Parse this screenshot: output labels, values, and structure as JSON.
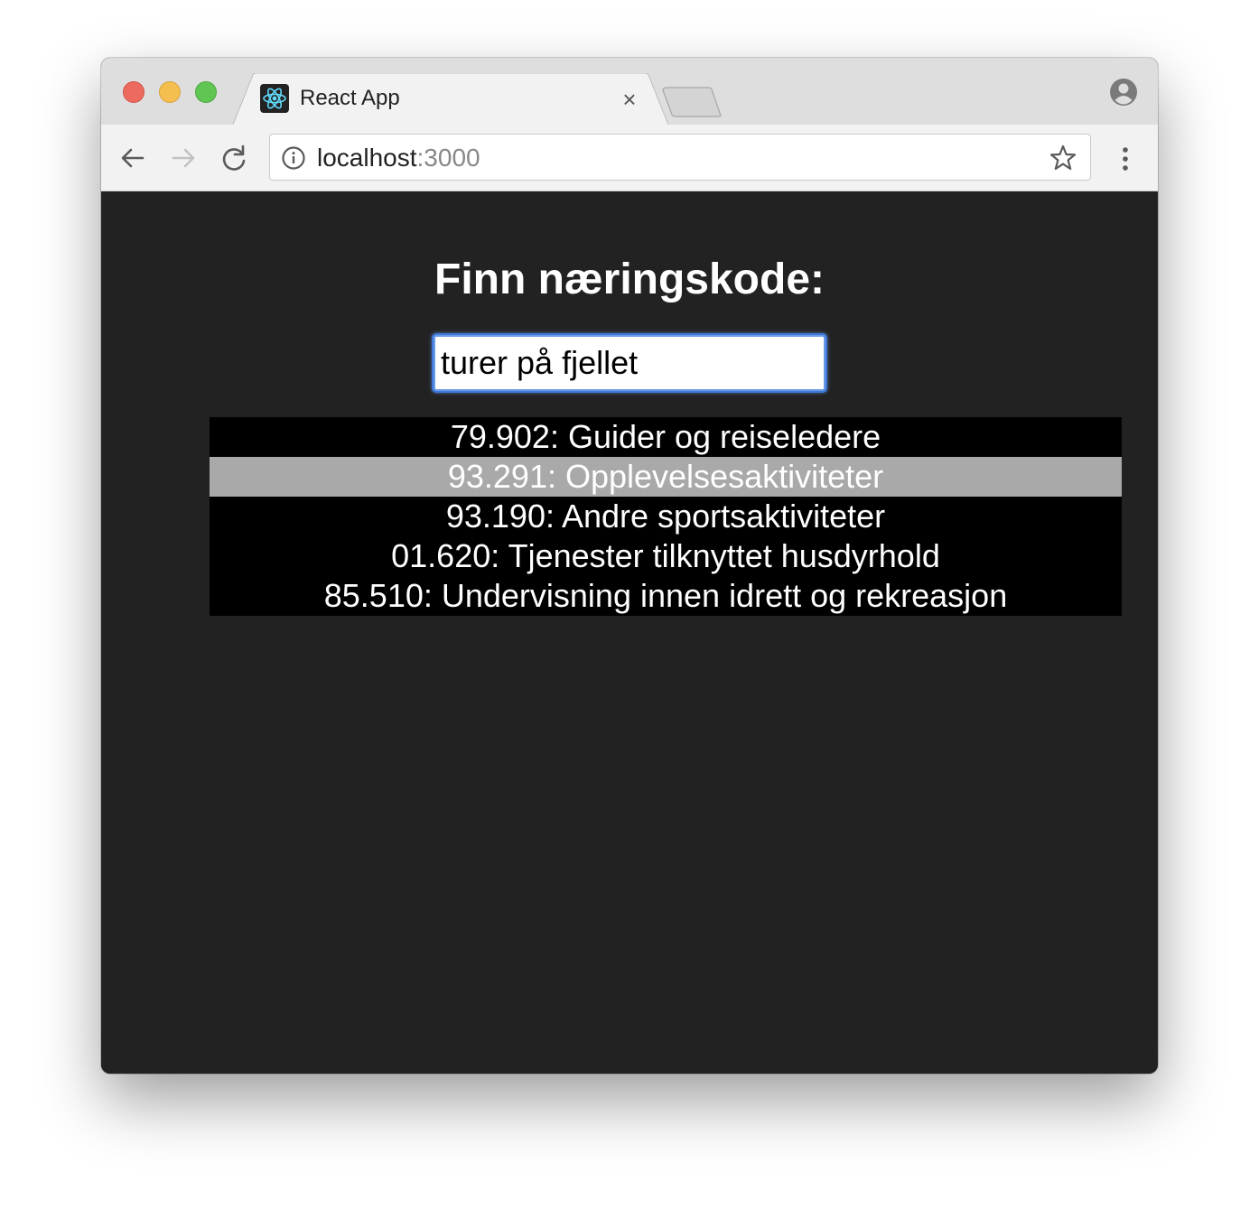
{
  "browser": {
    "tab_title": "React App",
    "tab_close": "×",
    "url_host": "localhost",
    "url_port": ":3000"
  },
  "page": {
    "heading": "Finn næringskode:",
    "search_value": "turer på fjellet",
    "results": [
      {
        "label": "79.902: Guider og reiseledere",
        "selected": false
      },
      {
        "label": "93.291: Opplevelsesaktiviteter",
        "selected": true
      },
      {
        "label": "93.190: Andre sportsaktiviteter",
        "selected": false
      },
      {
        "label": "01.620: Tjenester tilknyttet husdyrhold",
        "selected": false
      },
      {
        "label": "85.510: Undervisning innen idrett og rekreasjon",
        "selected": false
      }
    ]
  },
  "colors": {
    "page_background": "#222222",
    "results_background": "#000000",
    "selected_row": "#a9a9a9"
  }
}
